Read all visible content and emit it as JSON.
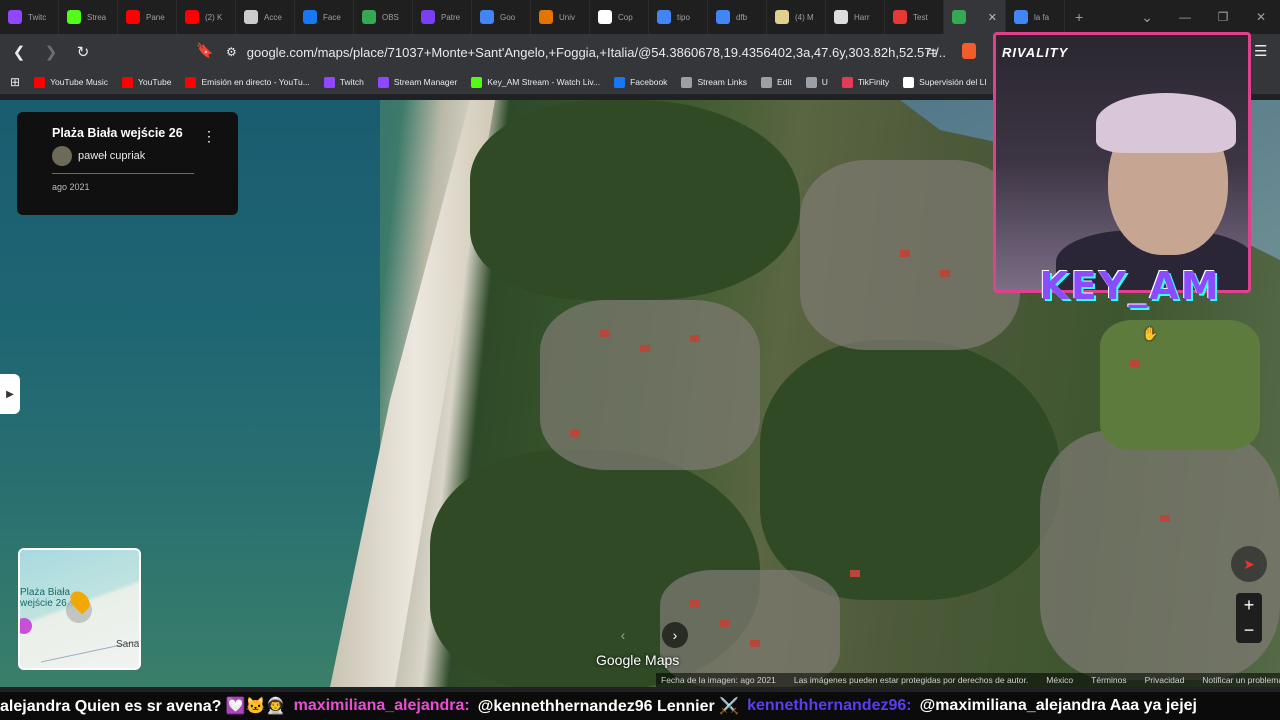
{
  "tabs": [
    {
      "label": "Twitc",
      "color": "#9146ff"
    },
    {
      "label": "Strea",
      "color": "#53fc18"
    },
    {
      "label": "Pane",
      "color": "#ff0000"
    },
    {
      "label": "(2) K",
      "color": "#ff0000"
    },
    {
      "label": "Acce",
      "color": "#cccccc"
    },
    {
      "label": "Face",
      "color": "#1877f2"
    },
    {
      "label": "OBS",
      "color": "#34a853"
    },
    {
      "label": "Patre",
      "color": "#7b3ff2"
    },
    {
      "label": "Goo",
      "color": "#4285f4"
    },
    {
      "label": "Univ",
      "color": "#e37400"
    },
    {
      "label": "Cop",
      "color": "#ffffff"
    },
    {
      "label": "tipo",
      "color": "#4285f4"
    },
    {
      "label": "dfb",
      "color": "#4285f4"
    },
    {
      "label": "(4) M",
      "color": "#e0d090"
    },
    {
      "label": "Harr",
      "color": "#dddddd"
    },
    {
      "label": "Test",
      "color": "#e53935"
    },
    {
      "label": "",
      "color": "#34a853",
      "active": true
    },
    {
      "label": "la fa",
      "color": "#4285f4"
    }
  ],
  "toolbar": {
    "url": "google.com/maps/place/71037+Monte+Sant'Angelo,+Foggia,+Italia/@54.3860678,19.4356402,3a,47.6y,303.82h,52.57t/..."
  },
  "bookmarks": [
    {
      "label": "YouTube Music",
      "color": "#ff0000"
    },
    {
      "label": "YouTube",
      "color": "#ff0000"
    },
    {
      "label": "Emisión en directo - YouTu...",
      "color": "#ff0000"
    },
    {
      "label": "Twitch",
      "color": "#9146ff"
    },
    {
      "label": "Stream Manager",
      "color": "#9146ff"
    },
    {
      "label": "Key_AM Stream - Watch Liv...",
      "color": "#53fc18"
    },
    {
      "label": "Facebook",
      "color": "#1877f2"
    },
    {
      "label": "Stream Links",
      "color": "#9aa0a6"
    },
    {
      "label": "Edit",
      "color": "#9aa0a6"
    },
    {
      "label": "U",
      "color": "#9aa0a6"
    },
    {
      "label": "TikFinity",
      "color": "#e33a5a"
    },
    {
      "label": "Supervisión del LI",
      "color": "#ffffff"
    }
  ],
  "info_card": {
    "title": "Plaża Biała wejście 26",
    "author": "paweł cupriak",
    "date": "ago 2021"
  },
  "minimap": {
    "label_line1": "Plaża Biała",
    "label_line2": "wejście 26",
    "place": "Sana"
  },
  "map": {
    "logo": "Google Maps",
    "attribution": {
      "date": "Fecha de la imagen: ago 2021",
      "rights": "Las imágenes pueden estar protegidas por derechos de autor.",
      "country": "México",
      "terms": "Términos",
      "privacy": "Privacidad",
      "report": "Notificar un problema"
    }
  },
  "overlay": {
    "brand": "RIVALITY",
    "streamer": "KEY_AM"
  },
  "chat": [
    {
      "text": "alejandra Quien es sr avena? 💟🐱👨‍🚀",
      "kind": "msg"
    },
    {
      "text": "maximiliana_alejandra:",
      "kind": "user"
    },
    {
      "text": "@kennethhernandez96 Lennier ⚔️",
      "kind": "msg"
    },
    {
      "text": "kennethhernandez96:",
      "kind": "user2"
    },
    {
      "text": "@maximiliana_alejandra Aaa ya jejej",
      "kind": "msg"
    }
  ]
}
